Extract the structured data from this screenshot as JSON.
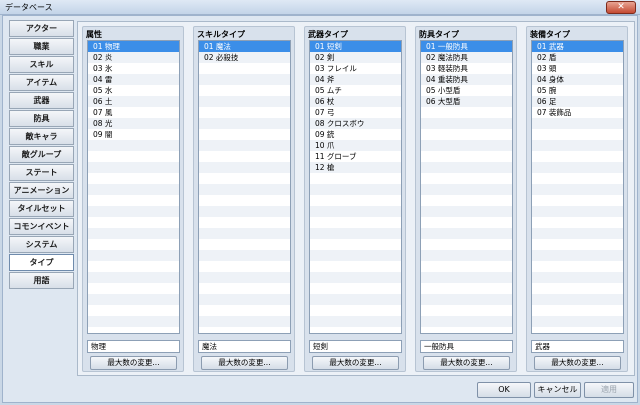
{
  "window": {
    "title": "データベース",
    "close_label": "✕"
  },
  "nav": {
    "items": [
      {
        "label": "アクター"
      },
      {
        "label": "職業"
      },
      {
        "label": "スキル"
      },
      {
        "label": "アイテム"
      },
      {
        "label": "武器"
      },
      {
        "label": "防具"
      },
      {
        "label": "敵キャラ"
      },
      {
        "label": "敵グループ"
      },
      {
        "label": "ステート"
      },
      {
        "label": "アニメーション"
      },
      {
        "label": "タイルセット"
      },
      {
        "label": "コモンイベント"
      },
      {
        "label": "システム"
      },
      {
        "label": "タイプ",
        "active": true
      },
      {
        "label": "用語"
      }
    ]
  },
  "columns": [
    {
      "title": "属性",
      "items": [
        "01 物理",
        "02 炎",
        "03 氷",
        "04 雷",
        "05 水",
        "06 土",
        "07 風",
        "08 光",
        "09 闇"
      ],
      "selected": 0,
      "field_value": "物理",
      "button": "最大数の変更..."
    },
    {
      "title": "スキルタイプ",
      "items": [
        "01 魔法",
        "02 必殺技"
      ],
      "selected": 0,
      "field_value": "魔法",
      "button": "最大数の変更..."
    },
    {
      "title": "武器タイプ",
      "items": [
        "01 短剣",
        "02 剣",
        "03 フレイル",
        "04 斧",
        "05 ムチ",
        "06 杖",
        "07 弓",
        "08 クロスボウ",
        "09 銃",
        "10 爪",
        "11 グローブ",
        "12 槍"
      ],
      "selected": 0,
      "field_value": "短剣",
      "button": "最大数の変更..."
    },
    {
      "title": "防具タイプ",
      "items": [
        "01 一般防具",
        "02 魔法防具",
        "03 軽装防具",
        "04 重装防具",
        "05 小型盾",
        "06 大型盾"
      ],
      "selected": 0,
      "field_value": "一般防具",
      "button": "最大数の変更..."
    },
    {
      "title": "装備タイプ",
      "items": [
        "01 武器",
        "02 盾",
        "03 頭",
        "04 身体",
        "05 腕",
        "06 足",
        "07 装飾品"
      ],
      "selected": 0,
      "field_value": "武器",
      "button": "最大数の変更..."
    }
  ],
  "footer": {
    "ok": "OK",
    "cancel": "キャンセル",
    "apply": "適用"
  }
}
